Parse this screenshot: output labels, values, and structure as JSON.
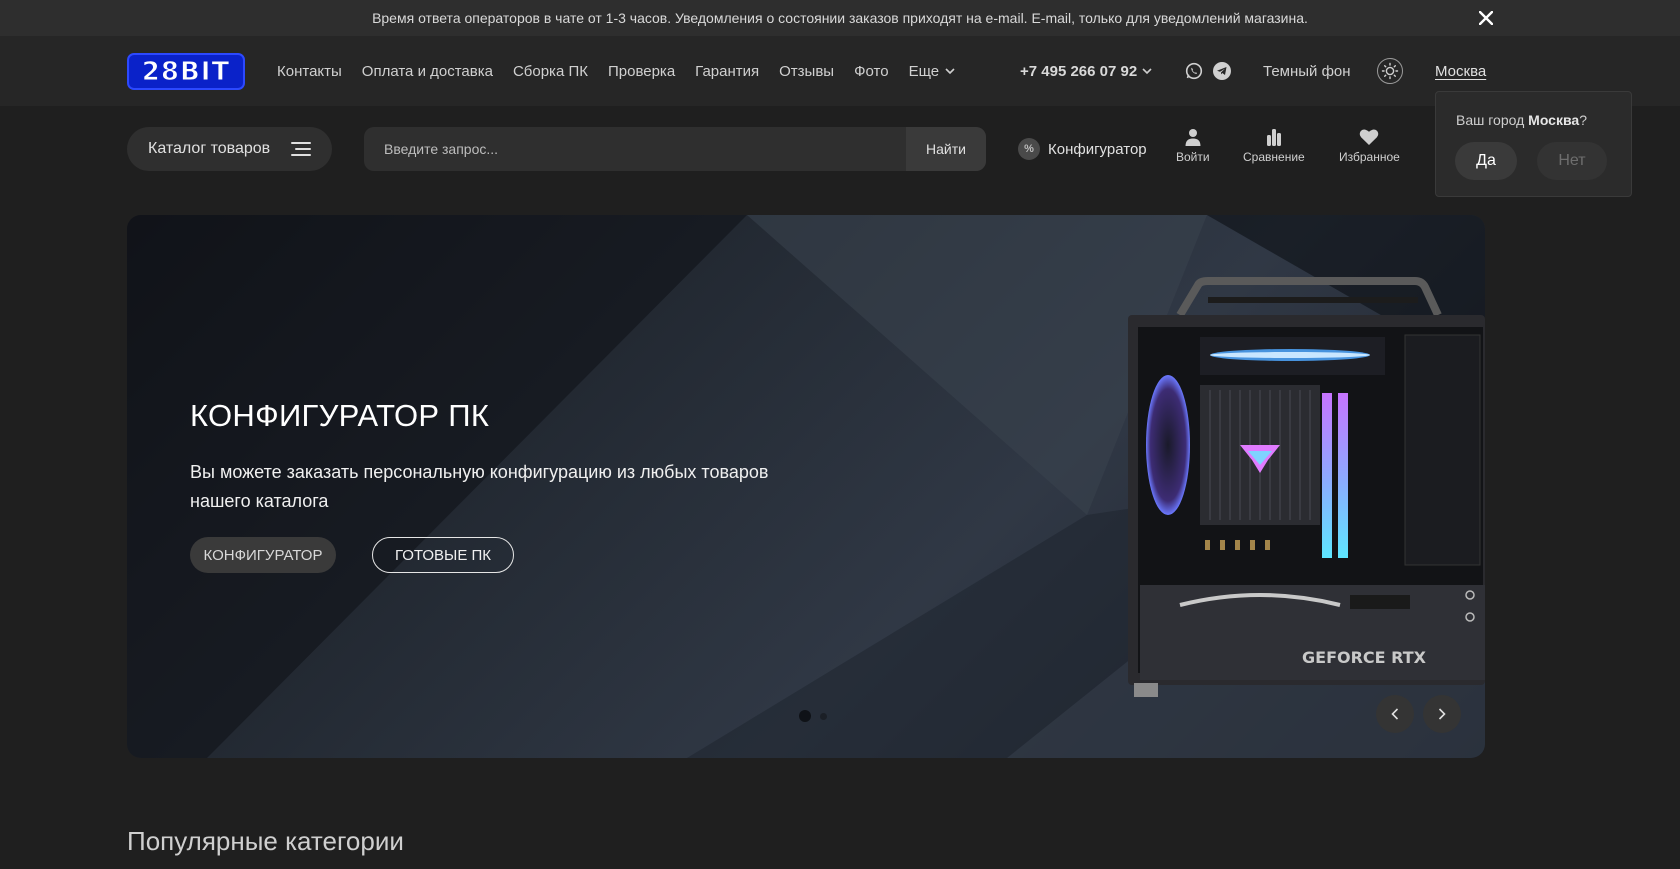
{
  "notice": {
    "text": "Время ответа операторов в чате от 1-3 часов. Уведомления о состоянии заказов приходят на e-mail. E-mail, только для уведомлений магазина."
  },
  "header": {
    "logo_text": "28BIT",
    "nav": [
      "Контакты",
      "Оплата и доставка",
      "Сборка ПК",
      "Проверка",
      "Гарантия",
      "Отзывы",
      "Фото"
    ],
    "more_label": "Еще",
    "phone": "+7 495 266 07 92",
    "dark_theme_label": "Темный фон",
    "city": "Москва"
  },
  "city_popup": {
    "question_prefix": "Ваш город ",
    "city": "Москва",
    "question_suffix": "?",
    "yes_label": "Да",
    "no_label": "Нет"
  },
  "search_row": {
    "catalog_label": "Каталог товаров",
    "search_placeholder": "Введите запрос...",
    "search_button": "Найти",
    "configurator_label": "Конфигуратор",
    "login_label": "Войти",
    "compare_label": "Сравнение",
    "favorites_label": "Избранное"
  },
  "hero": {
    "title": "КОНФИГУРАТОР ПК",
    "text": "Вы можете заказать персональную конфигурацию из любых товаров нашего каталога",
    "primary_button": "КОНФИГУРАТОР",
    "secondary_button": "ГОТОВЫЕ ПК",
    "gpu_label": "GEFORCE RTX",
    "slide_count": 2,
    "active_slide": 1
  },
  "sections": {
    "popular_title": "Популярные категории"
  },
  "colors": {
    "background": "#1f1f1f",
    "header": "#262626",
    "logo_blue": "#0a22c9"
  }
}
